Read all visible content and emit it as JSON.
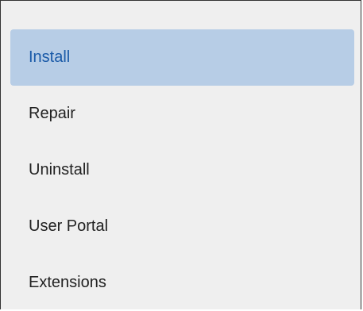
{
  "menu": {
    "items": [
      {
        "label": "Install",
        "active": true
      },
      {
        "label": "Repair",
        "active": false
      },
      {
        "label": "Uninstall",
        "active": false
      },
      {
        "label": "User Portal",
        "active": false
      },
      {
        "label": "Extensions",
        "active": false
      }
    ]
  },
  "colors": {
    "panel_background": "#efefef",
    "active_background": "#b7cde6",
    "active_text": "#1a5aa8",
    "text": "#222222",
    "border": "#333333"
  }
}
